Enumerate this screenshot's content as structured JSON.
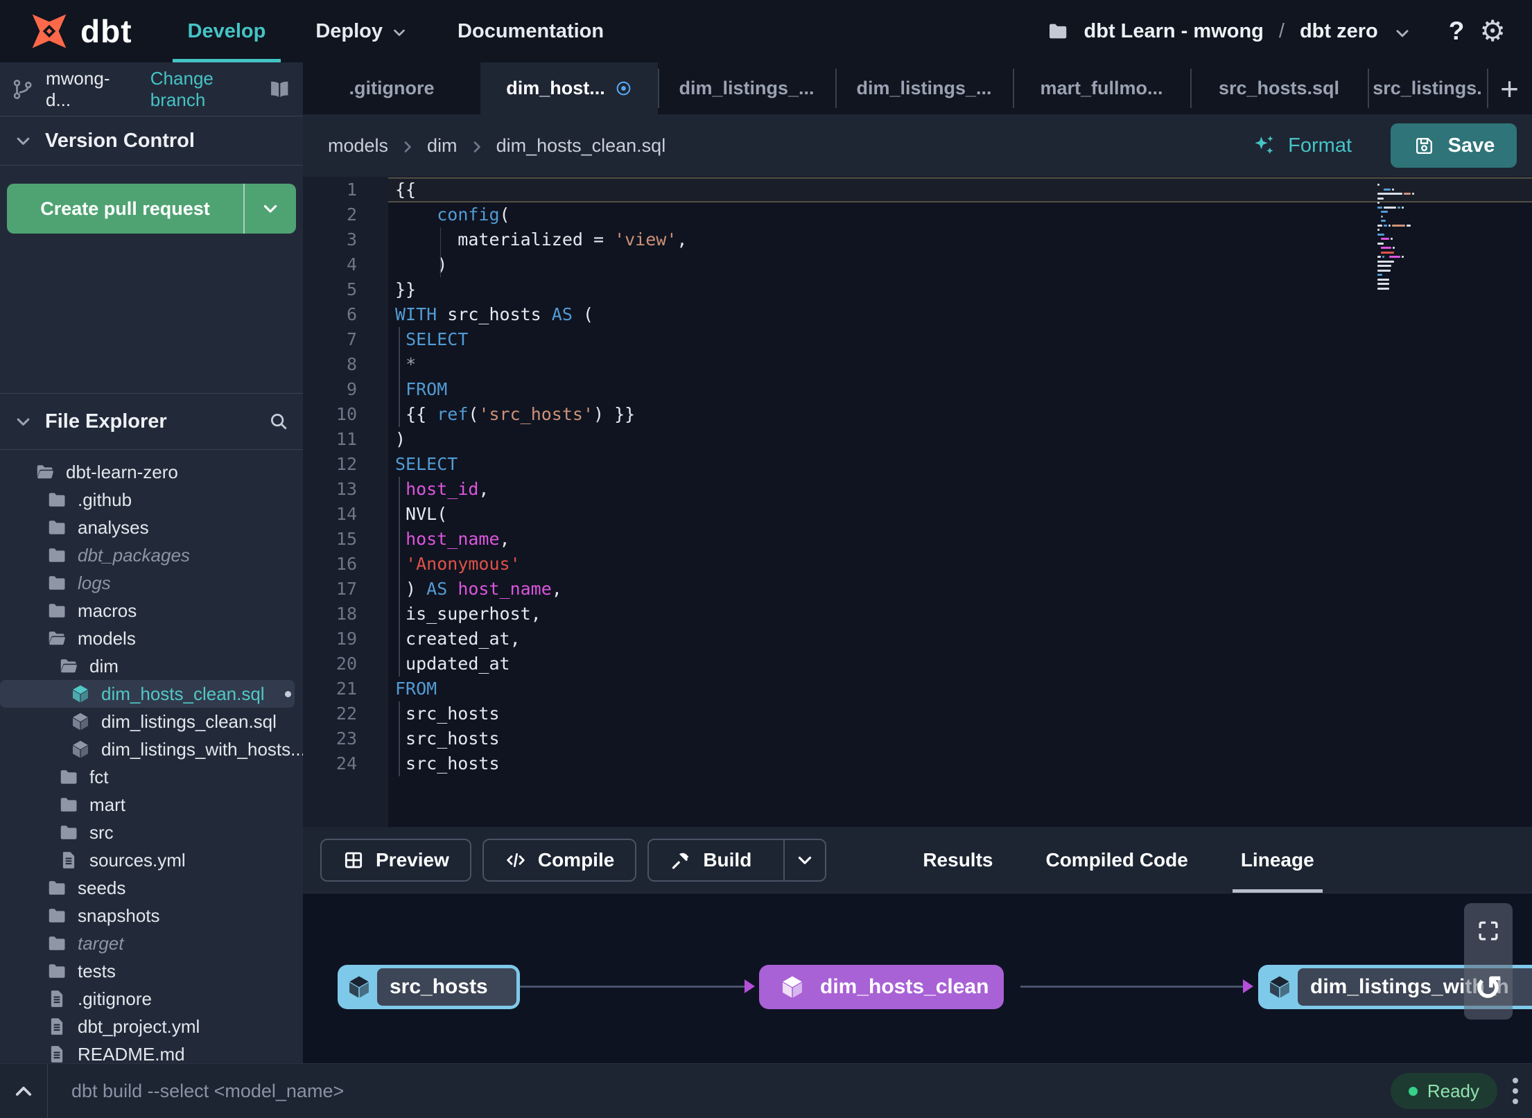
{
  "colors": {
    "accent_teal": "#45c4c6",
    "brand_orange": "#ff694a",
    "keyword_blue": "#539bd4",
    "identifier_magenta": "#dd55dd",
    "string_salmon": "#ce9178",
    "string_red": "#e05149",
    "pr_button_green": "#4fa373",
    "save_button_teal": "#2e7478",
    "ready_green": "#35d08a",
    "node_source_blue": "#7ec9ea",
    "node_model_purple": "#a961d6",
    "unsaved_indicator_blue": "#58a6f2"
  },
  "navbar": {
    "logo_text": "dbt",
    "menu": [
      {
        "label": "Develop",
        "active": true
      },
      {
        "label": "Deploy",
        "chevron": true
      },
      {
        "label": "Documentation"
      }
    ],
    "project": {
      "account": "dbt Learn - mwong",
      "separator": "/",
      "environment": "dbt zero"
    },
    "help_label": "?"
  },
  "sidebar": {
    "branch": {
      "name": "mwong-d...",
      "change_label": "Change branch"
    },
    "version_control": {
      "title": "Version Control",
      "create_pr_label": "Create pull request"
    },
    "file_explorer": {
      "title": "File Explorer"
    },
    "tree": [
      {
        "name": "dbt-learn-zero",
        "icon": "folder-open",
        "depth": 0
      },
      {
        "name": ".github",
        "icon": "folder",
        "depth": 1
      },
      {
        "name": "analyses",
        "icon": "folder",
        "depth": 1
      },
      {
        "name": "dbt_packages",
        "icon": "folder",
        "depth": 1,
        "italic": true
      },
      {
        "name": "logs",
        "icon": "folder",
        "depth": 1,
        "italic": true
      },
      {
        "name": "macros",
        "icon": "folder",
        "depth": 1
      },
      {
        "name": "models",
        "icon": "folder-open",
        "depth": 1
      },
      {
        "name": "dim",
        "icon": "folder-open",
        "depth": 2
      },
      {
        "name": "dim_hosts_clean.sql",
        "icon": "cube",
        "depth": 3,
        "selected": true,
        "modified": true
      },
      {
        "name": "dim_listings_clean.sql",
        "icon": "cube",
        "depth": 3
      },
      {
        "name": "dim_listings_with_hosts...",
        "icon": "cube",
        "depth": 3
      },
      {
        "name": "fct",
        "icon": "folder",
        "depth": 2
      },
      {
        "name": "mart",
        "icon": "folder",
        "depth": 2
      },
      {
        "name": "src",
        "icon": "folder",
        "depth": 2
      },
      {
        "name": "sources.yml",
        "icon": "file",
        "depth": 2
      },
      {
        "name": "seeds",
        "icon": "folder",
        "depth": 1
      },
      {
        "name": "snapshots",
        "icon": "folder",
        "depth": 1
      },
      {
        "name": "target",
        "icon": "folder",
        "depth": 1,
        "italic": true
      },
      {
        "name": "tests",
        "icon": "folder",
        "depth": 1
      },
      {
        "name": ".gitignore",
        "icon": "file",
        "depth": 1
      },
      {
        "name": "dbt_project.yml",
        "icon": "file",
        "depth": 1
      },
      {
        "name": "README.md",
        "icon": "file",
        "depth": 1
      }
    ]
  },
  "tabs": {
    "add_label": "+",
    "items": [
      {
        "label": ".gitignore"
      },
      {
        "label": "dim_host...",
        "active": true,
        "dirty": true
      },
      {
        "label": "dim_listings_..."
      },
      {
        "label": "dim_listings_..."
      },
      {
        "label": "mart_fullmo..."
      },
      {
        "label": "src_hosts.sql"
      },
      {
        "label": "src_listings."
      }
    ]
  },
  "editor": {
    "breadcrumb": [
      "models",
      "dim",
      "dim_hosts_clean.sql"
    ],
    "format_label": "Format",
    "save_label": "Save",
    "lines": [
      {
        "cur": true,
        "t": [
          [
            "p",
            "{{"
          ]
        ]
      },
      {
        "t": [
          [
            "p",
            "    "
          ],
          [
            "kw",
            "config"
          ],
          [
            "p",
            "("
          ]
        ]
      },
      {
        "g": [
          4.3
        ],
        "t": [
          [
            "p",
            "      materialized = "
          ],
          [
            "str",
            "'view'"
          ],
          [
            "p",
            ","
          ]
        ]
      },
      {
        "g": [
          4.3
        ],
        "t": [
          [
            "p",
            "    )"
          ]
        ]
      },
      {
        "t": [
          [
            "p",
            "}}"
          ]
        ]
      },
      {
        "t": [
          [
            "kw",
            "WITH"
          ],
          [
            "p",
            " src_hosts "
          ],
          [
            "kw",
            "AS"
          ],
          [
            "p",
            " ("
          ]
        ]
      },
      {
        "g": [
          0.35
        ],
        "t": [
          [
            "p",
            " "
          ],
          [
            "kw",
            "SELECT"
          ]
        ]
      },
      {
        "g": [
          0.35
        ],
        "t": [
          [
            "p",
            " "
          ],
          [
            "op",
            "*"
          ]
        ]
      },
      {
        "g": [
          0.35
        ],
        "t": [
          [
            "p",
            " "
          ],
          [
            "kw",
            "FROM"
          ]
        ]
      },
      {
        "g": [
          0.35
        ],
        "t": [
          [
            "p",
            " {{ "
          ],
          [
            "kw",
            "ref"
          ],
          [
            "p",
            "("
          ],
          [
            "str",
            "'src_hosts'"
          ],
          [
            "p",
            ") }}"
          ]
        ]
      },
      {
        "t": [
          [
            "p",
            ")"
          ]
        ]
      },
      {
        "t": [
          [
            "kw",
            "SELECT"
          ]
        ]
      },
      {
        "g": [
          0.35
        ],
        "t": [
          [
            "p",
            " "
          ],
          [
            "id",
            "host_id"
          ],
          [
            "p",
            ","
          ]
        ]
      },
      {
        "g": [
          0.35
        ],
        "t": [
          [
            "p",
            " NVL("
          ]
        ]
      },
      {
        "g": [
          0.35
        ],
        "t": [
          [
            "p",
            " "
          ],
          [
            "id",
            "host_name"
          ],
          [
            "p",
            ","
          ]
        ]
      },
      {
        "g": [
          0.35
        ],
        "t": [
          [
            "p",
            " "
          ],
          [
            "str2",
            "'Anonymous'"
          ]
        ]
      },
      {
        "g": [
          0.35
        ],
        "t": [
          [
            "p",
            " ) "
          ],
          [
            "kw",
            "AS"
          ],
          [
            "p",
            " "
          ],
          [
            "id",
            "host_name"
          ],
          [
            "p",
            ","
          ]
        ]
      },
      {
        "g": [
          0.35
        ],
        "t": [
          [
            "p",
            " is_superhost,"
          ]
        ]
      },
      {
        "g": [
          0.35
        ],
        "t": [
          [
            "p",
            " created_at,"
          ]
        ]
      },
      {
        "g": [
          0.35
        ],
        "t": [
          [
            "p",
            " updated_at"
          ]
        ]
      },
      {
        "t": [
          [
            "kw",
            "FROM"
          ]
        ]
      },
      {
        "g": [
          0.35
        ],
        "t": [
          [
            "p",
            " src_hosts"
          ]
        ]
      },
      {
        "g": [
          0.35
        ],
        "t": [
          [
            "p",
            " src_hosts"
          ]
        ]
      },
      {
        "g": [
          0.35
        ],
        "t": [
          [
            "p",
            " src_hosts"
          ]
        ]
      }
    ]
  },
  "bottom": {
    "preview_label": "Preview",
    "compile_label": "Compile",
    "build_label": "Build",
    "panel_tabs": [
      {
        "label": "Results"
      },
      {
        "label": "Compiled Code"
      },
      {
        "label": "Lineage",
        "active": true
      }
    ],
    "lineage_nodes": [
      {
        "label": "src_hosts",
        "style": "source"
      },
      {
        "label": "dim_hosts_clean",
        "style": "model"
      },
      {
        "label": "dim_listings_with_h",
        "style": "source"
      }
    ]
  },
  "statusbar": {
    "command": "dbt build --select <model_name>",
    "ready_label": "Ready"
  }
}
